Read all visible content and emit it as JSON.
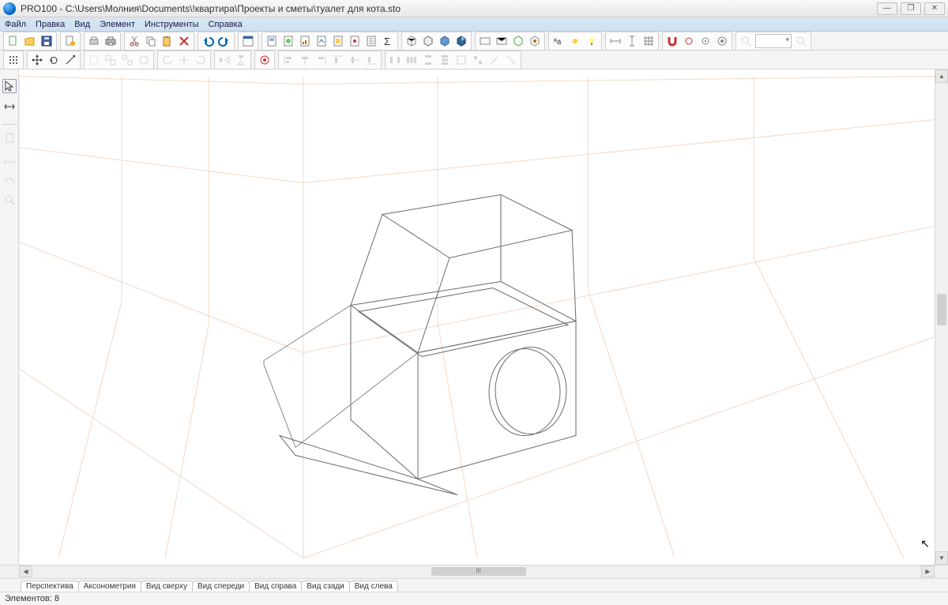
{
  "app": {
    "name": "PRO100",
    "file_path": "C:\\Users\\Молния\\Documents\\!квартира\\Проекты и сметы\\туалет для кота.sto"
  },
  "menu": {
    "file": "Файл",
    "edit": "Правка",
    "view": "Вид",
    "element": "Элемент",
    "tools": "Инструменты",
    "help": "Справка"
  },
  "view_tabs": {
    "perspective": "Перспектива",
    "axonometry": "Аксонометрия",
    "top": "Вид сверху",
    "front": "Вид спереди",
    "right": "Вид справа",
    "back": "Вид сзади",
    "left": "Вид слева"
  },
  "status": {
    "elements": "Элементов: 8"
  },
  "scroll_marker": "III"
}
